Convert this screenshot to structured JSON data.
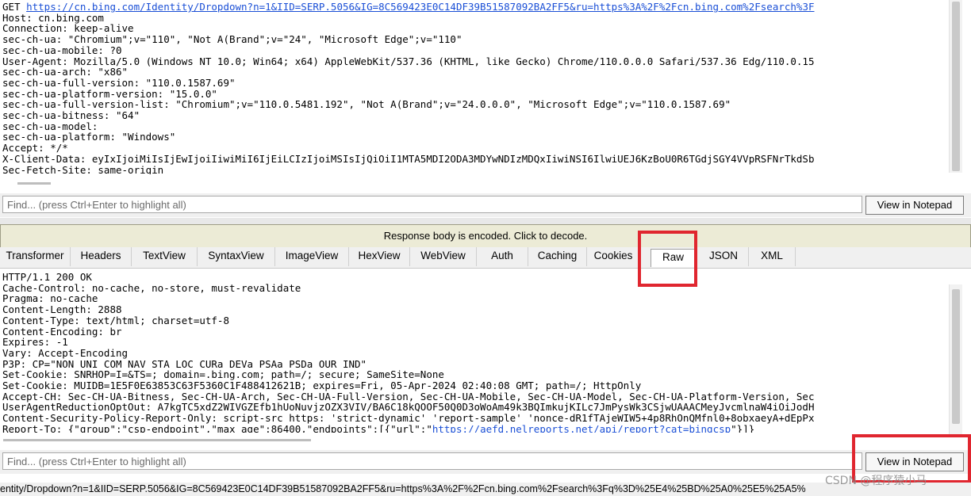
{
  "request": {
    "lines": [
      {
        "prefix": "GET ",
        "link": "https://cn.bing.com/Identity/Dropdown?n=1&IID=SERP.5056&IG=8C569423E0C14DF39B51587092BA2FF5&ru=https%3A%2F%2Fcn.bing.com%2Fsearch%3F"
      },
      {
        "text": "Host: cn.bing.com"
      },
      {
        "text": "Connection: keep-alive"
      },
      {
        "text": "sec-ch-ua: \"Chromium\";v=\"110\", \"Not A(Brand\";v=\"24\", \"Microsoft Edge\";v=\"110\""
      },
      {
        "text": "sec-ch-ua-mobile: ?0"
      },
      {
        "text": "User-Agent: Mozilla/5.0 (Windows NT 10.0; Win64; x64) AppleWebKit/537.36 (KHTML, like Gecko) Chrome/110.0.0.0 Safari/537.36 Edg/110.0.15"
      },
      {
        "text": "sec-ch-ua-arch: \"x86\""
      },
      {
        "text": "sec-ch-ua-full-version: \"110.0.1587.69\""
      },
      {
        "text": "sec-ch-ua-platform-version: \"15.0.0\""
      },
      {
        "text": "sec-ch-ua-full-version-list: \"Chromium\";v=\"110.0.5481.192\", \"Not A(Brand\";v=\"24.0.0.0\", \"Microsoft Edge\";v=\"110.0.1587.69\""
      },
      {
        "text": "sec-ch-ua-bitness: \"64\""
      },
      {
        "text": "sec-ch-ua-model:"
      },
      {
        "text": "sec-ch-ua-platform: \"Windows\""
      },
      {
        "text": "Accept: */*"
      },
      {
        "text": "X-Client-Data: eyIxIjoiMiIsIjEwIjoiIiwiMiI6IjEiLCIzIjoiMSIsIjQiOiI1MTA5MDI2ODA3MDYwNDIzMDQxIiwiNSI6IlwiUEJ6KzBoU0R6TGdjSGY4VVpRSFNrTkdSb"
      },
      {
        "text": "Sec-Fetch-Site: same-origin"
      }
    ]
  },
  "find_top": {
    "placeholder": "Find... (press Ctrl+Enter to highlight all)",
    "button": "View in Notepad"
  },
  "decode_banner": "Response body is encoded. Click to decode.",
  "tabs": [
    {
      "label": "Transformer"
    },
    {
      "label": "Headers"
    },
    {
      "label": "TextView"
    },
    {
      "label": "SyntaxView"
    },
    {
      "label": "ImageView"
    },
    {
      "label": "HexView"
    },
    {
      "label": "WebView"
    },
    {
      "label": "Auth"
    },
    {
      "label": "Caching"
    },
    {
      "label": "Cookies"
    },
    {
      "label": "Raw",
      "active": true
    },
    {
      "label": "JSON"
    },
    {
      "label": "XML"
    }
  ],
  "response": {
    "lines": [
      {
        "text": "HTTP/1.1 200 OK"
      },
      {
        "text": "Cache-Control: no-cache, no-store, must-revalidate"
      },
      {
        "text": "Pragma: no-cache"
      },
      {
        "text": "Content-Length: 2888"
      },
      {
        "text": "Content-Type: text/html; charset=utf-8"
      },
      {
        "text": "Content-Encoding: br"
      },
      {
        "text": "Expires: -1"
      },
      {
        "text": "Vary: Accept-Encoding"
      },
      {
        "text": "P3P: CP=\"NON UNI COM NAV STA LOC CURa DEVa PSAa PSDa OUR IND\""
      },
      {
        "text": "Set-Cookie: SNRHOP=I=&TS=; domain=.bing.com; path=/; secure; SameSite=None"
      },
      {
        "text": "Set-Cookie: MUIDB=1E5F0E63853C63F5360C1F488412621B; expires=Fri, 05-Apr-2024 02:40:08 GMT; path=/; HttpOnly"
      },
      {
        "text": "Accept-CH: Sec-CH-UA-Bitness, Sec-CH-UA-Arch, Sec-CH-UA-Full-Version, Sec-CH-UA-Mobile, Sec-CH-UA-Model, Sec-CH-UA-Platform-Version, Sec"
      },
      {
        "text": "UserAgentReductionOptOut: A7kgTC5xdZ2WIVGZEfb1hUoNuvjzOZX3VIV/BA6C18kQOOF50Q0D3oWoAm49k3BQImkujKILc7JmPysWk3CSjwUAAACMeyJvcmlnaW4iOiJodH"
      },
      {
        "text": "Content-Security-Policy-Report-Only: script-src https: 'strict-dynamic' 'report-sample' 'nonce-dR1fTAjeWIW5+4p8RhOnQMfnl0+8obxaeyA+dEpPx"
      },
      {
        "prefix": "Report-To: {\"group\":\"csp-endpoint\",\"max_age\":86400,\"endpoints\":[{\"url\":\"",
        "link": "https://aefd.nelreports.net/api/report?cat=bingcsp",
        "suffix": "\"}]}"
      }
    ]
  },
  "find_bottom": {
    "placeholder": "Find... (press Ctrl+Enter to highlight all)",
    "button": "View in Notepad"
  },
  "status_url": "entity/Dropdown?n=1&IID=SERP.5056&IG=8C569423E0C14DF39B51587092BA2FF5&ru=https%3A%2F%2Fcn.bing.com%2Fsearch%3Fq%3D%25E4%25BD%25A0%25E5%25A5%",
  "watermark": "CSDN @程序猿小马",
  "colors": {
    "highlight": "#e0262f",
    "link": "#1a4fd6",
    "banner": "#ecebd6"
  }
}
